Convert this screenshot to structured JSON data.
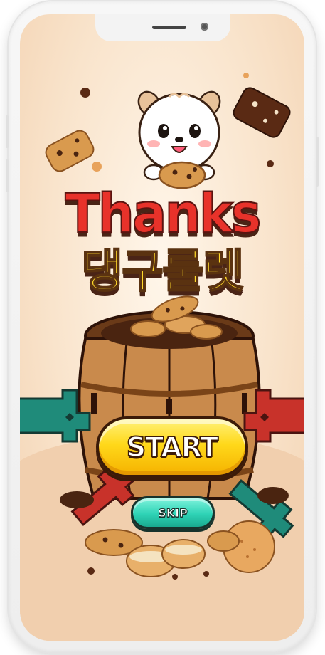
{
  "game": {
    "title_en": "Thanks",
    "title_ko": "댕구룰렛",
    "start_label": "START",
    "skip_label": "SKIP"
  },
  "theme": {
    "background": "#f9e4cc",
    "title_red": "#e8322a",
    "title_yellow": "#ffd92a",
    "start_button": "#ffd81a",
    "skip_button": "#2fd3b6",
    "outline": "#3b1a08"
  },
  "icons": {
    "mascot": "white-puppy-mascot",
    "barrel": "wooden-barrel",
    "swords": "pirate-swords",
    "cookies": "chocolate-chip-cookies"
  }
}
